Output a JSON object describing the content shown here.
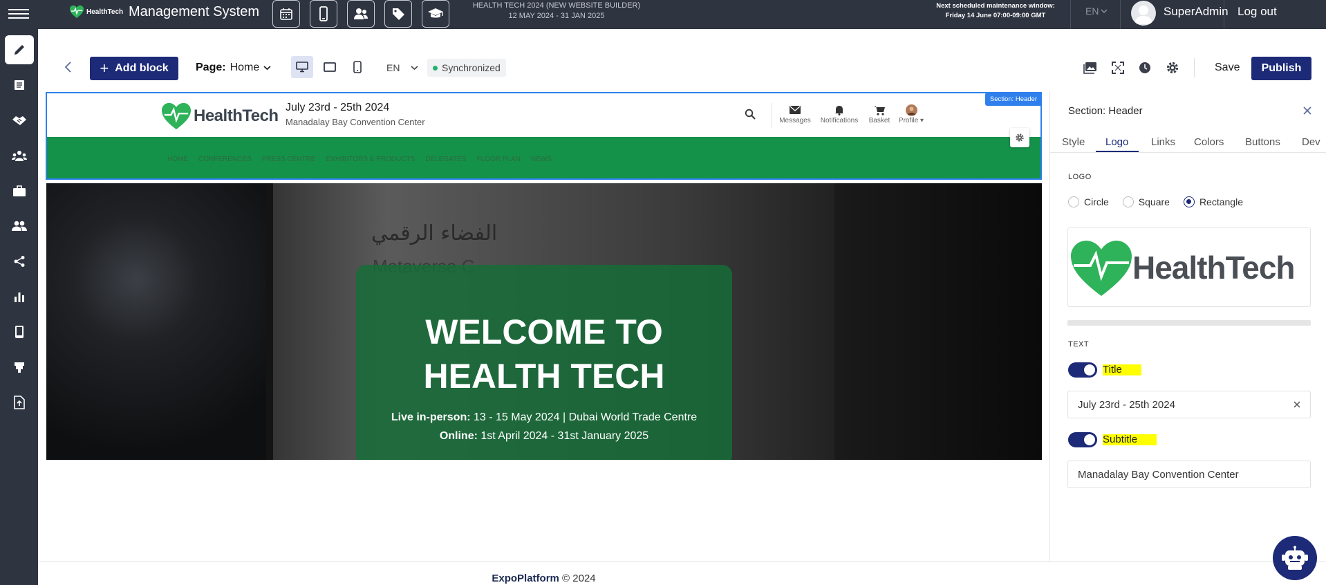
{
  "colors": {
    "topbar": "#2f3441",
    "primary": "#1c2a78",
    "green": "#14924a",
    "accent_blue": "#2f80ed",
    "highlight": "#ffff00",
    "sync": "#23b26d"
  },
  "topbar": {
    "logo_text": "HealthTech",
    "app_title": "Management System",
    "icons": [
      "calendar-icon",
      "mobile-icon",
      "people-icon",
      "tag-icon",
      "graduation-cap-icon"
    ],
    "event_name": "HEALTH TECH 2024 (NEW WEBSITE BUILDER)",
    "event_dates": "12 MAY 2024 - 31 JAN 2025",
    "maintenance_label": "Next scheduled maintenance window:",
    "maintenance_time": "Friday 14 June 07:00-09:00 GMT",
    "language": "EN",
    "user_name": "SuperAdmin",
    "logout_label": "Log out"
  },
  "leftnav": {
    "items": [
      "pencil-icon",
      "document-icon",
      "handshake-icon",
      "organization-icon",
      "briefcase-icon",
      "people-icon",
      "share-icon",
      "bar-chart-icon",
      "mobile-icon",
      "booth-icon",
      "file-upload-icon"
    ]
  },
  "toolbar": {
    "add_block_label": "Add block",
    "page_label": "Page:",
    "page_value": "Home",
    "language": "EN",
    "sync_status": "Synchronized",
    "save_label": "Save",
    "publish_label": "Publish"
  },
  "preview": {
    "logo_text": "HealthTech",
    "title": "July 23rd - 25th 2024",
    "subtitle": "Manadalay Bay Convention Center",
    "tools": [
      "Messages",
      "Notifications",
      "Basket",
      "Profile"
    ],
    "nav": [
      "HOME",
      "CONFERENCES",
      "PRESS CENTRE",
      "EXHIBITORS & PRODUCTS",
      "DELEGATES",
      "FLOOR PLAN",
      "NEWS"
    ],
    "section_badge": "Section: Header",
    "hero": {
      "arabic_text": "الفضاء الرقمي",
      "meta_text": "Metaverse C",
      "title_line1": "WELCOME TO",
      "title_line2": "HEALTH TECH",
      "live_label": "Live in-person:",
      "live_value": " 13  - 15 May 2024 | Dubai World Trade Centre",
      "online_label": "Online:",
      "online_value": " 1st April 2024 - 31st January 2025"
    }
  },
  "panel": {
    "title": "Section: Header",
    "tabs": [
      "Style",
      "Logo",
      "Links",
      "Colors",
      "Buttons",
      "Dev"
    ],
    "active_tab": "Logo",
    "logo_label": "LOGO",
    "shape_options": [
      "Circle",
      "Square",
      "Rectangle"
    ],
    "selected_shape": "Rectangle",
    "logo_preview_text": "HealthTech",
    "text_label": "TEXT",
    "title_toggle_label": "Title",
    "title_toggle_on": true,
    "title_value": "July 23rd - 25th 2024",
    "subtitle_toggle_label": "Subtitle",
    "subtitle_toggle_on": true,
    "subtitle_value": "Manadalay Bay Convention Center"
  },
  "footer": {
    "brand": "ExpoPlatform",
    "copyright": " © 2024"
  }
}
